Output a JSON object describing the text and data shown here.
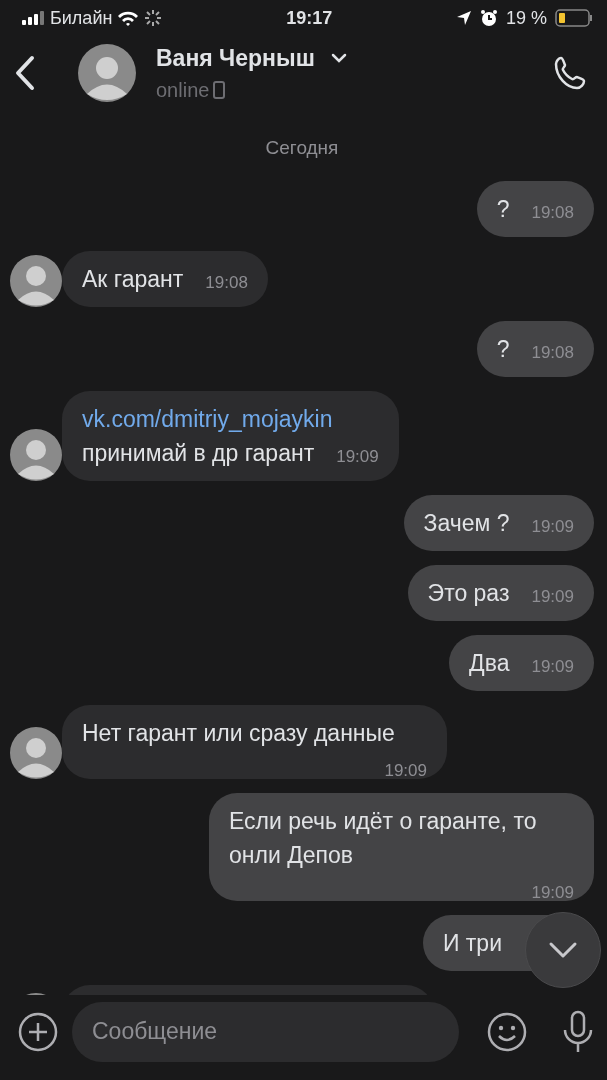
{
  "status_bar": {
    "carrier": "Билайн",
    "time": "19:17",
    "battery": "19 %"
  },
  "header": {
    "name": "Ваня Черныш",
    "status": "online"
  },
  "date_divider": "Сегодня",
  "messages": [
    {
      "kind": "out",
      "text": "?",
      "time": "19:08"
    },
    {
      "kind": "in",
      "text": "Ак гарант",
      "time": "19:08"
    },
    {
      "kind": "out",
      "text": "?",
      "time": "19:08"
    },
    {
      "kind": "in",
      "link": "vk.com/dmitriy_mojaykin",
      "text": "принимай в др гарант",
      "time": "19:09"
    },
    {
      "kind": "out",
      "text": "Зачем ?",
      "time": "19:09"
    },
    {
      "kind": "out",
      "text": "Это раз",
      "time": "19:09"
    },
    {
      "kind": "out",
      "text": "Два",
      "time": "19:09"
    },
    {
      "kind": "in",
      "text": "Нет гарант или сразу данные",
      "time": "19:09"
    },
    {
      "kind": "out",
      "text": "Если речь идёт о гаранте, то онли Депов",
      "time": "19:09"
    },
    {
      "kind": "out",
      "text": "И три"
    },
    {
      "kind": "in",
      "cut": true
    }
  ],
  "composer": {
    "placeholder": "Сообщение"
  }
}
